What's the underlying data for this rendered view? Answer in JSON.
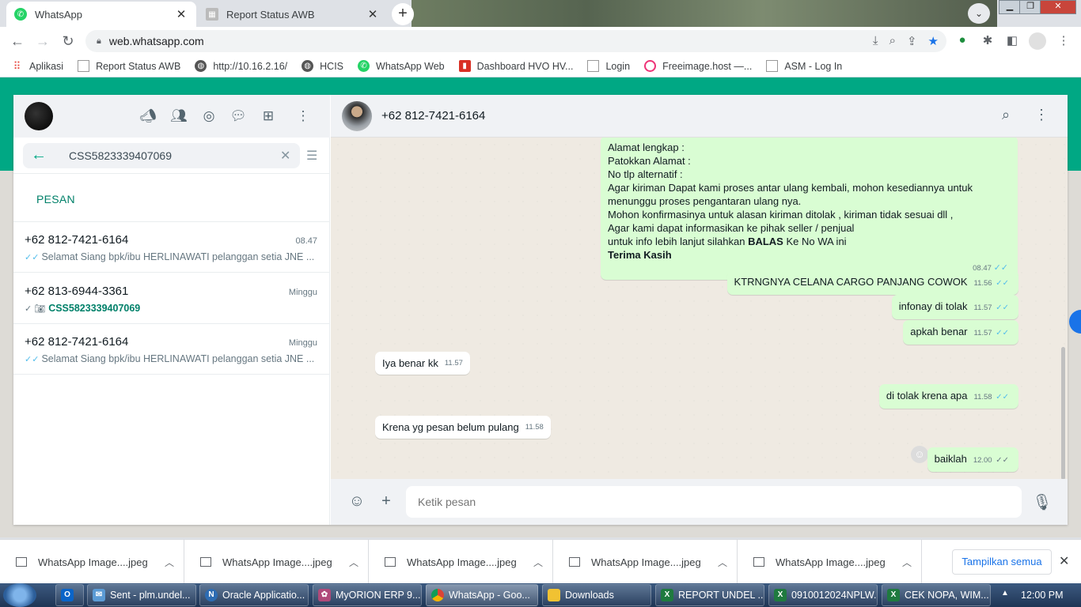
{
  "browser": {
    "tabs": [
      {
        "label": "WhatsApp",
        "active": true
      },
      {
        "label": "Report Status AWB",
        "active": false
      }
    ],
    "new_tab": "+",
    "url": "web.whatsapp.com",
    "bookmarks": [
      "Aplikasi",
      "Report Status AWB",
      "http://10.16.2.16/",
      "HCIS",
      "WhatsApp Web",
      "Dashboard HVO HV...",
      "Login",
      "Freeimage.host —...",
      "ASM - Log In"
    ]
  },
  "sidebar": {
    "search_value": "CSS5823339407069",
    "section_label": "PESAN",
    "results": [
      {
        "name": "+62 812-7421-6164",
        "time": "08.47",
        "snippet": "Selamat Siang   bpk/ibu HERLINAWATI pelanggan setia JNE ..."
      },
      {
        "name": "+62 813-6944-3361",
        "time": "Minggu",
        "snippet": "CSS5823339407069"
      },
      {
        "name": "+62 812-7421-6164",
        "time": "Minggu",
        "snippet": "Selamat Siang   bpk/ibu HERLINAWATI pelanggan setia JNE ..."
      }
    ]
  },
  "chat": {
    "contact_name": "+62 812-7421-6164",
    "big_message": {
      "lines": [
        "Alamat  lengkap :",
        "Patokkan Alamat :",
        "No tlp alternatif :",
        "Agar kiriman Dapat kami proses antar ulang kembali, mohon kesediannya untuk",
        "menunggu proses pengantaran ulang nya.",
        "Mohon konfirmasinya untuk alasan kiriman ditolak , kiriman tidak sesuai dll ,",
        "Agar kami dapat informasikan ke pihak seller / penjual"
      ],
      "line_before_bold": "untuk info lebih lanjut silahkan ",
      "bold_word": "BALAS",
      "line_after_bold": " Ke No WA ini",
      "closing": "Terima Kasih",
      "time": "08.47"
    },
    "messages": [
      {
        "text": "KTRNGNYA CELANA CARGO PANJANG COWOK",
        "time": "11.56",
        "dir": "out"
      },
      {
        "text": "infonay di tolak",
        "time": "11.57",
        "dir": "out"
      },
      {
        "text": "apkah benar",
        "time": "11.57",
        "dir": "out"
      },
      {
        "text": "Iya benar kk",
        "time": "11.57",
        "dir": "in"
      },
      {
        "text": "di tolak krena apa",
        "time": "11.58",
        "dir": "out"
      },
      {
        "text": "Krena yg pesan belum pulang",
        "time": "11.58",
        "dir": "in"
      },
      {
        "text": "baiklah",
        "time": "12.00",
        "dir": "out"
      }
    ],
    "composer_placeholder": "Ketik pesan"
  },
  "downloads": {
    "items": [
      "WhatsApp Image....jpeg",
      "WhatsApp Image....jpeg",
      "WhatsApp Image....jpeg",
      "WhatsApp Image....jpeg",
      "WhatsApp Image....jpeg"
    ],
    "show_all": "Tampilkan semua"
  },
  "taskbar": {
    "items": [
      "Sent - plm.undel...",
      "Oracle Applicatio...",
      "MyORION ERP 9....",
      "WhatsApp - Goo...",
      "Downloads",
      "REPORT UNDEL ...",
      "0910012024NPLW...",
      "CEK NOPA, WIM..."
    ],
    "clock": "12:00 PM"
  },
  "colors": {
    "whatsapp_green": "#00a884",
    "outgoing_bubble": "#d9fdd3",
    "read_tick": "#53bdeb"
  }
}
